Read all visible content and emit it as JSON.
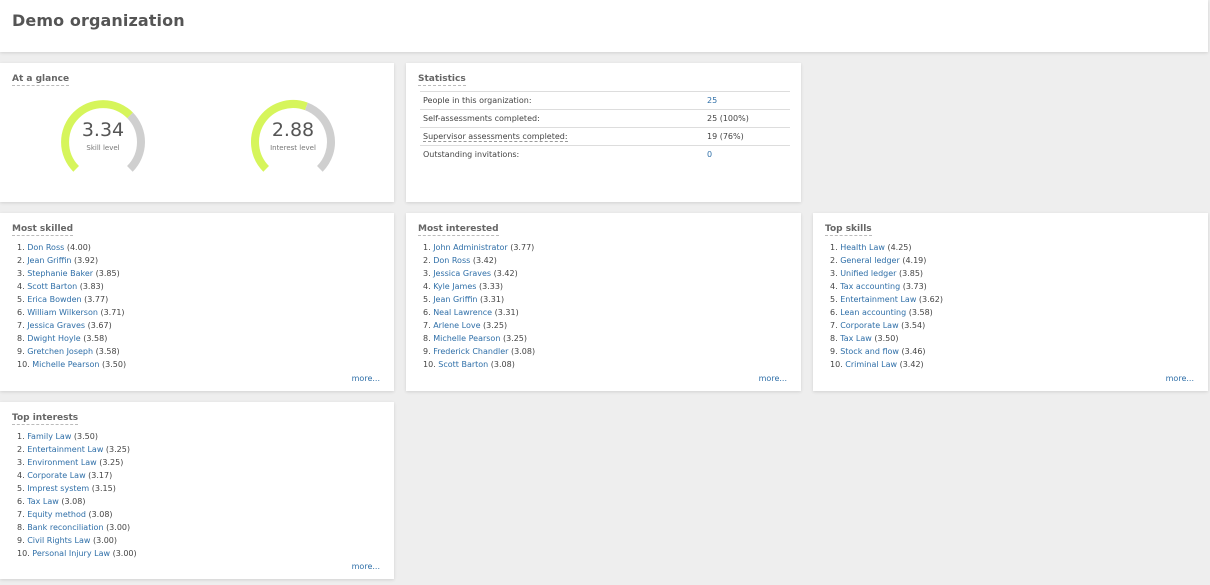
{
  "header": {
    "title": "Demo organization"
  },
  "at_a_glance": {
    "title": "At a glance",
    "gauges": [
      {
        "value": "3.34",
        "label": "Skill level",
        "fraction": 0.668
      },
      {
        "value": "2.88",
        "label": "Interest level",
        "fraction": 0.576
      }
    ],
    "colors": {
      "fill": "#d6f55b",
      "track": "#cfcfcf"
    }
  },
  "statistics": {
    "title": "Statistics",
    "rows": [
      {
        "label": "People in this organization:",
        "value": "25",
        "link": true,
        "dashed": false
      },
      {
        "label": "Self-assessments completed:",
        "value": "25 (100%)",
        "link": false,
        "dashed": false
      },
      {
        "label": "Supervisor assessments completed:",
        "value": "19 (76%)",
        "link": false,
        "dashed": true
      },
      {
        "label": "Outstanding invitations:",
        "value": "0",
        "link": true,
        "dashed": false
      }
    ]
  },
  "most_skilled": {
    "title": "Most skilled",
    "more": "more...",
    "items": [
      {
        "num": "1.",
        "name": "Don Ross",
        "score": "(4.00)"
      },
      {
        "num": "2.",
        "name": "Jean Griffin",
        "score": "(3.92)"
      },
      {
        "num": "3.",
        "name": "Stephanie Baker",
        "score": "(3.85)"
      },
      {
        "num": "4.",
        "name": "Scott Barton",
        "score": "(3.83)"
      },
      {
        "num": "5.",
        "name": "Erica Bowden",
        "score": "(3.77)"
      },
      {
        "num": "6.",
        "name": "William Wilkerson",
        "score": "(3.71)"
      },
      {
        "num": "7.",
        "name": "Jessica Graves",
        "score": "(3.67)"
      },
      {
        "num": "8.",
        "name": "Dwight Hoyle",
        "score": "(3.58)"
      },
      {
        "num": "9.",
        "name": "Gretchen Joseph",
        "score": "(3.58)"
      },
      {
        "num": "10.",
        "name": "Michelle Pearson",
        "score": "(3.50)"
      }
    ]
  },
  "most_interested": {
    "title": "Most interested",
    "more": "more...",
    "items": [
      {
        "num": "1.",
        "name": "John Administrator",
        "score": "(3.77)"
      },
      {
        "num": "2.",
        "name": "Don Ross",
        "score": "(3.42)"
      },
      {
        "num": "3.",
        "name": "Jessica Graves",
        "score": "(3.42)"
      },
      {
        "num": "4.",
        "name": "Kyle James",
        "score": "(3.33)"
      },
      {
        "num": "5.",
        "name": "Jean Griffin",
        "score": "(3.31)"
      },
      {
        "num": "6.",
        "name": "Neal Lawrence",
        "score": "(3.31)"
      },
      {
        "num": "7.",
        "name": "Arlene Love",
        "score": "(3.25)"
      },
      {
        "num": "8.",
        "name": "Michelle Pearson",
        "score": "(3.25)"
      },
      {
        "num": "9.",
        "name": "Frederick Chandler",
        "score": "(3.08)"
      },
      {
        "num": "10.",
        "name": "Scott Barton",
        "score": "(3.08)"
      }
    ]
  },
  "top_skills": {
    "title": "Top skills",
    "more": "more...",
    "items": [
      {
        "num": "1.",
        "name": "Health Law",
        "score": "(4.25)"
      },
      {
        "num": "2.",
        "name": "General ledger",
        "score": "(4.19)"
      },
      {
        "num": "3.",
        "name": "Unified ledger",
        "score": "(3.85)"
      },
      {
        "num": "4.",
        "name": "Tax accounting",
        "score": "(3.73)"
      },
      {
        "num": "5.",
        "name": "Entertainment Law",
        "score": "(3.62)"
      },
      {
        "num": "6.",
        "name": "Lean accounting",
        "score": "(3.58)"
      },
      {
        "num": "7.",
        "name": "Corporate Law",
        "score": "(3.54)"
      },
      {
        "num": "8.",
        "name": "Tax Law",
        "score": "(3.50)"
      },
      {
        "num": "9.",
        "name": "Stock and flow",
        "score": "(3.46)"
      },
      {
        "num": "10.",
        "name": "Criminal Law",
        "score": "(3.42)"
      }
    ]
  },
  "top_interests": {
    "title": "Top interests",
    "more": "more...",
    "items": [
      {
        "num": "1.",
        "name": "Family Law",
        "score": "(3.50)"
      },
      {
        "num": "2.",
        "name": "Entertainment Law",
        "score": "(3.25)"
      },
      {
        "num": "3.",
        "name": "Environment Law",
        "score": "(3.25)"
      },
      {
        "num": "4.",
        "name": "Corporate Law",
        "score": "(3.17)"
      },
      {
        "num": "5.",
        "name": "Imprest system",
        "score": "(3.15)"
      },
      {
        "num": "6.",
        "name": "Tax Law",
        "score": "(3.08)"
      },
      {
        "num": "7.",
        "name": "Equity method",
        "score": "(3.08)"
      },
      {
        "num": "8.",
        "name": "Bank reconciliation",
        "score": "(3.00)"
      },
      {
        "num": "9.",
        "name": "Civil Rights Law",
        "score": "(3.00)"
      },
      {
        "num": "10.",
        "name": "Personal Injury Law",
        "score": "(3.00)"
      }
    ]
  }
}
